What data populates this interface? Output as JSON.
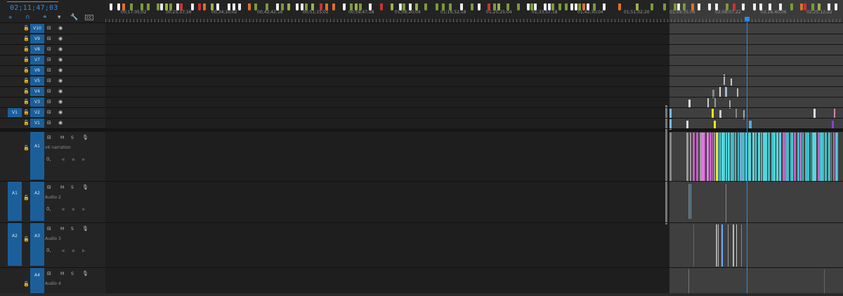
{
  "timecode": "02;11;47;03",
  "ruler": {
    "labels": [
      "00;17;05;02",
      "00;25;37;16",
      "00;34;10;02",
      "00;42;42;16",
      "00;51;15;02",
      "00;59;47;18",
      "01;08;20;04",
      "01;16;52;18",
      "01;25;25;04",
      "01;33;57;18",
      "01;42;30;04",
      "01;51;02;20",
      "01;59;35;06",
      "02;08;07;22",
      "02;16;40;06",
      "02;25;12;22"
    ]
  },
  "video_tracks": [
    {
      "label": "V10"
    },
    {
      "label": "V9"
    },
    {
      "label": "V8"
    },
    {
      "label": "V7"
    },
    {
      "label": "V6"
    },
    {
      "label": "V5"
    },
    {
      "label": "V4"
    },
    {
      "label": "V3"
    },
    {
      "label": "V2",
      "source": "V1"
    },
    {
      "label": "V1"
    }
  ],
  "audio_tracks": [
    {
      "label": "A1",
      "name": "v6 narration"
    },
    {
      "label": "A2",
      "name": "Audio 2",
      "source": "A1"
    },
    {
      "label": "A3",
      "name": "Audio 3",
      "source": "A2"
    },
    {
      "label": "A4",
      "name": "Audio 4"
    }
  ],
  "audio_buttons": {
    "mute": "M",
    "solo": "S"
  },
  "volume_label": "0,",
  "icons": {
    "snap": "snap-icon",
    "linked": "linked-selection-icon",
    "markers": "add-marker-icon",
    "settings": "wrench-icon",
    "captions": "captions-icon",
    "lock": "lock-icon",
    "toggle_output": "toggle-track-output-icon",
    "eye": "eye-icon",
    "mic": "microphone-icon"
  },
  "colors": {
    "accent": "#2d8ceb",
    "target": "#1b5f9a"
  }
}
